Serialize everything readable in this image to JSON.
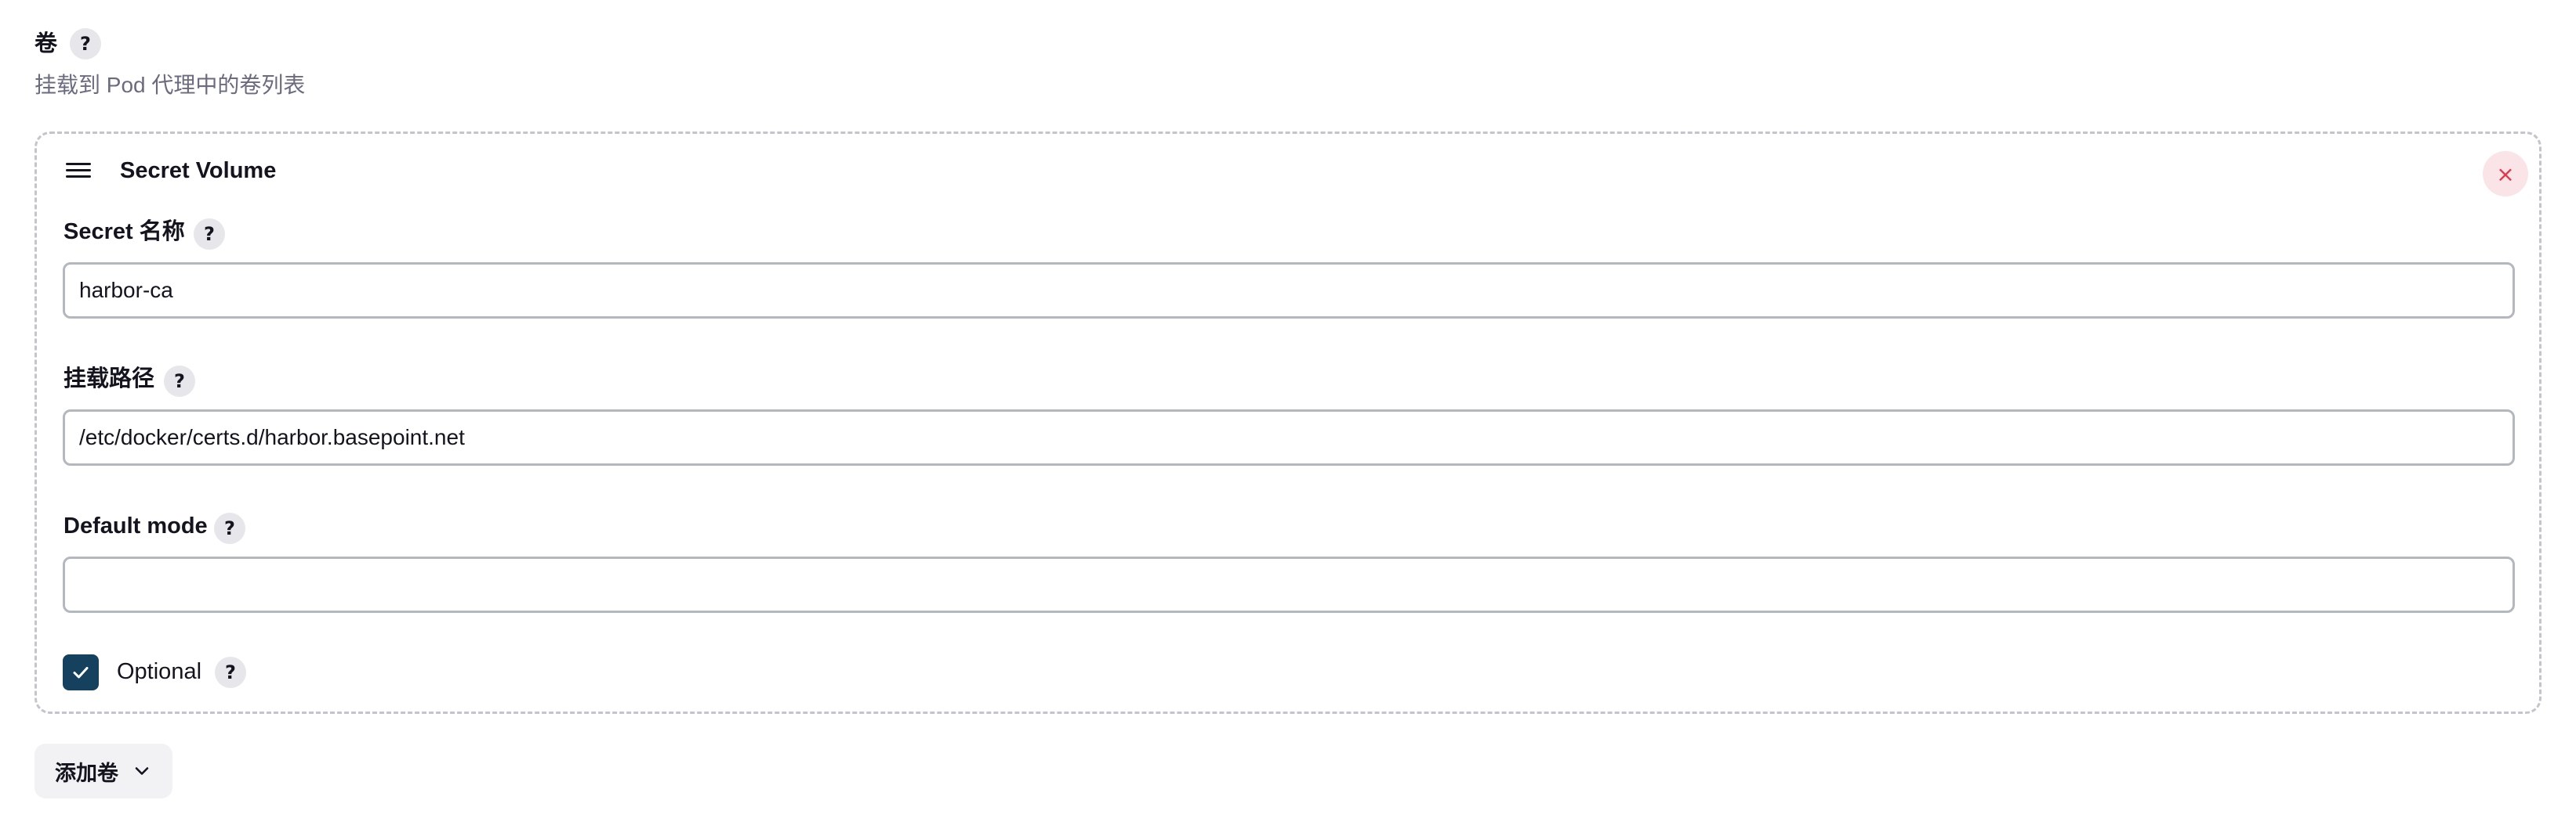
{
  "volumes_section": {
    "title": "卷",
    "help": "?",
    "description": "挂载到 Pod 代理中的卷列表"
  },
  "secret_volume": {
    "title": "Secret Volume",
    "close_icon": "×",
    "secret_name": {
      "label": "Secret 名称",
      "help": "?",
      "value": "harbor-ca"
    },
    "mount_path": {
      "label": "挂载路径",
      "help": "?",
      "value": "/etc/docker/certs.d/harbor.basepoint.net"
    },
    "default_mode": {
      "label": "Default mode",
      "help": "?",
      "value": ""
    },
    "optional": {
      "label": "Optional",
      "help": "?",
      "checked": true
    }
  },
  "add_volume_button": {
    "label": "添加卷"
  },
  "colors": {
    "accent": "#15405e",
    "danger": "#e5334a",
    "border": "#b3b8bf"
  }
}
